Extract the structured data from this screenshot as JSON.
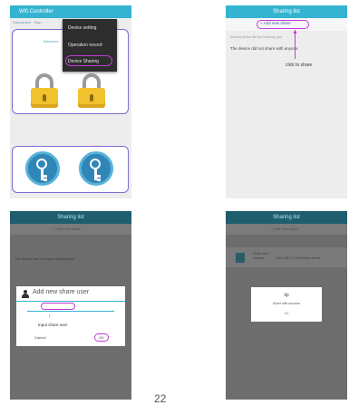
{
  "panel1": {
    "title": "Wifi Controller",
    "subheader": "Disconnect · Stop",
    "hint": "Welcome",
    "menu": [
      "Device setting",
      "Operation record",
      "Device Sharing"
    ]
  },
  "panel2": {
    "title": "Sharing list",
    "add_label": "+ Add new share",
    "list_header": "Sharing device list has following user",
    "empty_text": "The device did not share with anyone",
    "annotation": "click to share"
  },
  "panel3": {
    "title": "Sharing list",
    "add_label": "+ Add new share",
    "empty_text": "The device did not share with anyone",
    "dialog": {
      "title": "Add new share user",
      "input_label": "Input share user",
      "cancel": "Cancel",
      "ok": "OK"
    }
  },
  "panel4": {
    "title": "Sharing list",
    "add_label": "+ Add new share",
    "user": {
      "line1": "Share user",
      "line2": "account",
      "line3": "2017-06-17 13:55 share device"
    },
    "tip": {
      "title": "tip",
      "message": "Share with success",
      "ok": "OK"
    }
  },
  "page_number": "22",
  "colors": {
    "appbar": "#34b4d1",
    "annotation": "#c03bd6",
    "card_border": "#7e6bd1"
  }
}
